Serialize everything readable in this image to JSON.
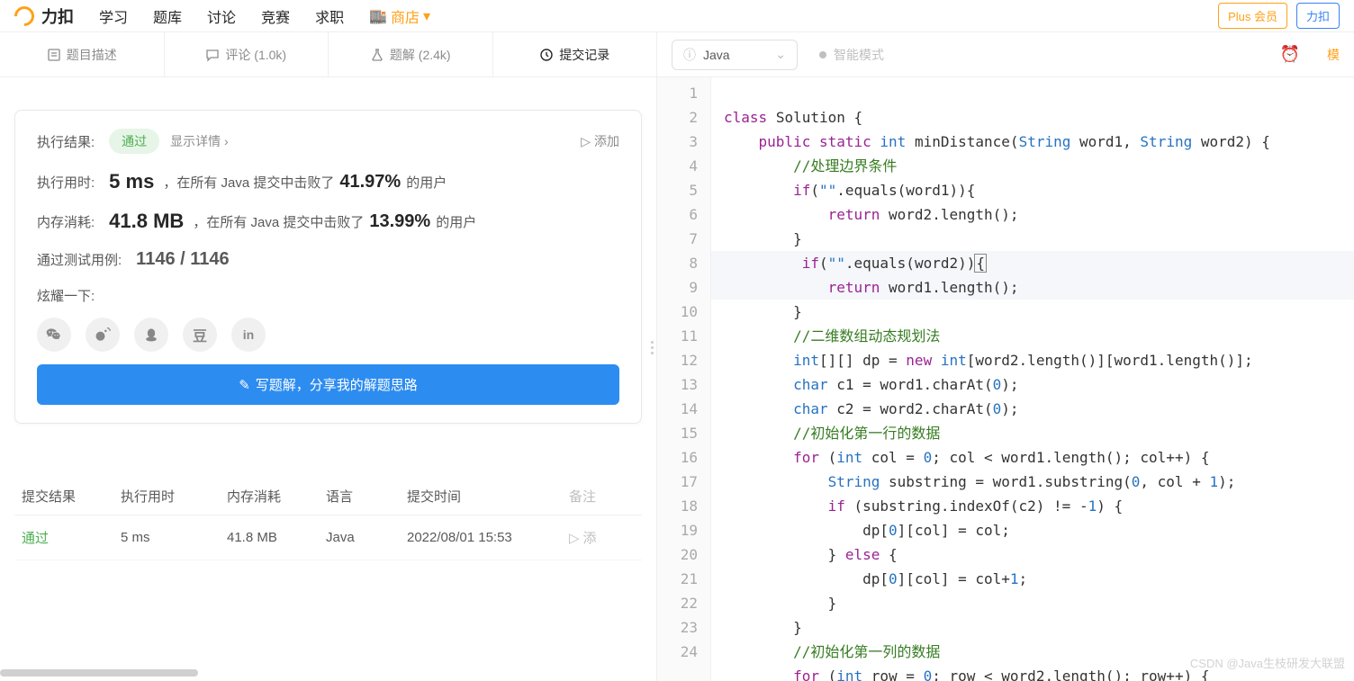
{
  "nav": {
    "brand": "力扣",
    "links": [
      "学习",
      "题库",
      "讨论",
      "竞赛",
      "求职"
    ],
    "store": "商店",
    "plus": "Plus 会员",
    "action": "力扣"
  },
  "tabs": {
    "desc": "题目描述",
    "comments": "评论 (1.0k)",
    "solutions": "题解 (2.4k)",
    "submissions": "提交记录"
  },
  "result": {
    "label": "执行结果:",
    "status": "通过",
    "detail": "显示详情 ›",
    "add": "添加",
    "time_label": "执行用时:",
    "time_val": "5 ms",
    "time_txt1": "，在所有 Java 提交中击败了",
    "time_pct": "41.97%",
    "time_txt2": "的用户",
    "mem_label": "内存消耗:",
    "mem_val": "41.8 MB",
    "mem_txt1": "，在所有 Java 提交中击败了",
    "mem_pct": "13.99%",
    "mem_txt2": "的用户",
    "cases_label": "通过测试用例:",
    "cases_val": "1146 / 1146",
    "share_label": "炫耀一下:",
    "write_btn": "写题解，分享我的解题思路"
  },
  "share_icons": [
    "wechat",
    "weibo",
    "qq",
    "douban",
    "linkedin"
  ],
  "table": {
    "headers": {
      "result": "提交结果",
      "time": "执行用时",
      "mem": "内存消耗",
      "lang": "语言",
      "date": "提交时间",
      "note": "备注"
    },
    "rows": [
      {
        "result": "通过",
        "time": "5 ms",
        "mem": "41.8 MB",
        "lang": "Java",
        "date": "2022/08/01 15:53",
        "note": "添"
      }
    ]
  },
  "editor": {
    "lang": "Java",
    "smart": "智能模式",
    "mode": "模"
  },
  "code": {
    "lines": 24,
    "c1": "//处理边界条件",
    "c2": "//二维数组动态规划法",
    "c3": "//初始化第一行的数据",
    "c4": "//初始化第一列的数据"
  },
  "watermark": "CSDN @Java生枝研发大联盟"
}
